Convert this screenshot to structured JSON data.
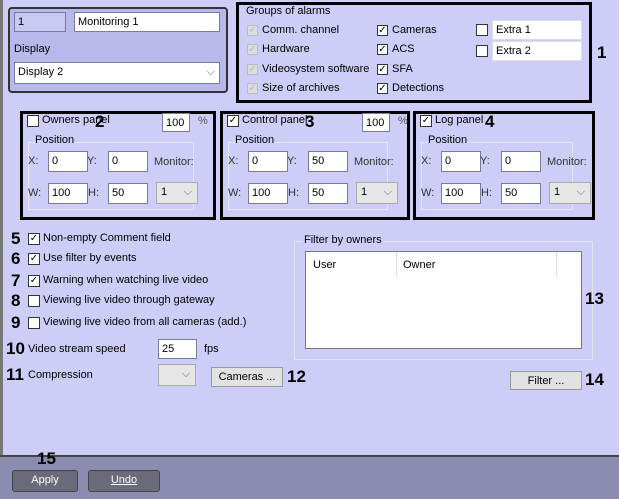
{
  "header": {
    "id": "1",
    "name": "Monitoring 1",
    "display_label": "Display",
    "display_value": "Display 2"
  },
  "alarms": {
    "title": "Groups of alarms",
    "col1": [
      {
        "label": "Comm. channel",
        "checked": true
      },
      {
        "label": "Hardware",
        "checked": true
      },
      {
        "label": "Videosystem software",
        "checked": true
      },
      {
        "label": "Size of archives",
        "checked": true
      }
    ],
    "col2": [
      {
        "label": "Cameras",
        "checked": true
      },
      {
        "label": "ACS",
        "checked": true
      },
      {
        "label": "SFA",
        "checked": true
      },
      {
        "label": "Detections",
        "checked": true
      }
    ],
    "extra": [
      {
        "label": "Extra 1",
        "checked": false
      },
      {
        "label": "Extra 2",
        "checked": false
      }
    ],
    "callout": "1"
  },
  "panels": [
    {
      "label": "Owners panel",
      "checked": false,
      "percent": "100",
      "callout": "2",
      "x": "0",
      "y": "0",
      "w": "100",
      "h": "50",
      "monitor": "1"
    },
    {
      "label": "Control panel",
      "checked": true,
      "percent": "100",
      "callout": "3",
      "x": "0",
      "y": "50",
      "w": "100",
      "h": "50",
      "monitor": "1"
    },
    {
      "label": "Log panel",
      "checked": true,
      "percent": "",
      "callout": "4",
      "x": "0",
      "y": "0",
      "w": "100",
      "h": "50",
      "monitor": "1"
    }
  ],
  "panel_labels": {
    "position": "Position",
    "x": "X:",
    "y": "Y:",
    "w": "W:",
    "h": "H:",
    "monitor": "Monitor:",
    "pct": "%"
  },
  "options": [
    {
      "n": "5",
      "label": "Non-empty Comment field",
      "checked": true
    },
    {
      "n": "6",
      "label": "Use filter by events",
      "checked": true
    },
    {
      "n": "7",
      "label": "Warning when watching live video",
      "checked": true
    },
    {
      "n": "8",
      "label": "Viewing live video through gateway",
      "checked": false
    },
    {
      "n": "9",
      "label": "Viewing live video from all cameras (add.)",
      "checked": false
    }
  ],
  "speed": {
    "n": "10",
    "label": "Video stream speed",
    "value": "25",
    "unit": "fps"
  },
  "compression": {
    "n": "11",
    "label": "Compression",
    "value": ""
  },
  "cameras_button": {
    "label": "Cameras ...",
    "n": "12"
  },
  "filter": {
    "title": "Filter by owners",
    "columns": [
      "User",
      "Owner"
    ],
    "n": "13",
    "button": "Filter ...",
    "button_n": "14"
  },
  "footer": {
    "n": "15",
    "apply": "Apply",
    "undo": "Undo"
  }
}
